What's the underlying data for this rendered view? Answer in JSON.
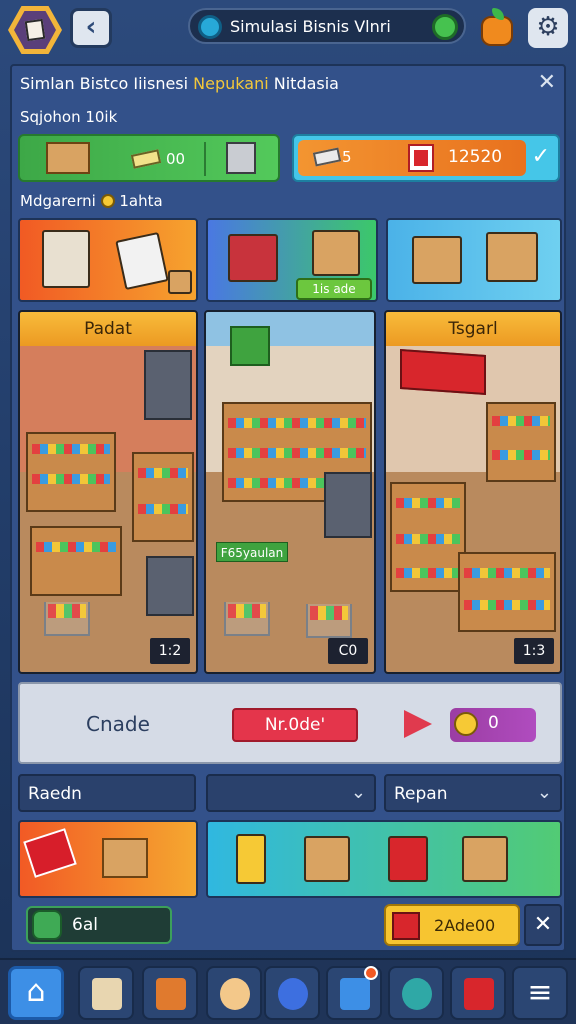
{
  "header": {
    "title": "Simulasi Bisnis Vlnri"
  },
  "panel": {
    "title_part1": "Simlan Bistco Iiisnesi",
    "title_highlight": "Nepukani",
    "title_part2": "Nitdasia",
    "section1_label": "Sqjohon 10ik",
    "section2_label": "Mdgarerni",
    "section2_suffix": "1ahta"
  },
  "stats": {
    "green_value": "00",
    "orange_value1": "5",
    "orange_value2": "12520"
  },
  "categories": {
    "badge": "1is ade"
  },
  "scenes": [
    {
      "header": "Padat",
      "value": "1:2"
    },
    {
      "header": "",
      "value": "C0",
      "tag": "F65yaulan"
    },
    {
      "header": "Tsgarl",
      "value": "1:3"
    }
  ],
  "craft": {
    "label": "Cnade",
    "button": "Nr.0de'",
    "result": "0"
  },
  "selectors": [
    {
      "label": "Raedn"
    },
    {
      "label": ""
    },
    {
      "label": "Repan"
    }
  ],
  "bottom": {
    "balance": "6al",
    "buy": "2Ade00"
  },
  "colors": {
    "accent": "#f3c83a",
    "panel": "#33518a",
    "danger": "#e4354b",
    "success": "#3da847"
  }
}
